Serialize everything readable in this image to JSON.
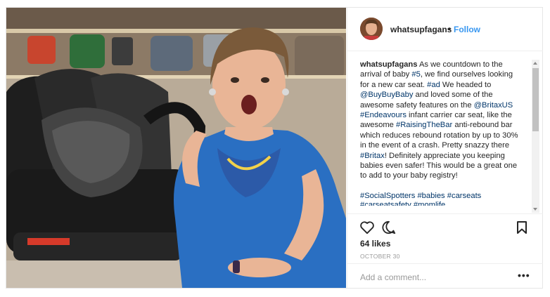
{
  "post": {
    "username": "whatsupfagans",
    "separator": "•",
    "follow_label": "Follow",
    "caption_user": "whatsupfagans",
    "caption_parts": [
      {
        "t": "As we countdown to the arrival of baby ",
        "k": "text"
      },
      {
        "t": "#5",
        "k": "link"
      },
      {
        "t": ", we find ourselves looking for a new car seat. ",
        "k": "text"
      },
      {
        "t": "#ad",
        "k": "link"
      },
      {
        "t": " We headed to ",
        "k": "text"
      },
      {
        "t": "@BuyBuyBaby",
        "k": "link"
      },
      {
        "t": " and loved some of the awesome safety features on the ",
        "k": "text"
      },
      {
        "t": "@BritaxUS",
        "k": "link"
      },
      {
        "t": " ",
        "k": "text"
      },
      {
        "t": "#Endeavours",
        "k": "link"
      },
      {
        "t": " infant carrier car seat, like the awesome ",
        "k": "text"
      },
      {
        "t": "#RaisingTheBar",
        "k": "link"
      },
      {
        "t": " anti-rebound bar which reduces rebound rotation by up to 30% in the event of a crash. Pretty snazzy there ",
        "k": "text"
      },
      {
        "t": "#Britax",
        "k": "link"
      },
      {
        "t": "! Definitely appreciate you keeping babies even safer! This would be a great one to add to your baby registry!",
        "k": "text"
      }
    ],
    "hashtags_line": "#SocialSpotters #babies #carseats",
    "hashtags_cut": "#carseatsafety #momlife",
    "likes": "64 likes",
    "date": "OCTOBER 30",
    "comment_placeholder": "Add a comment...",
    "more_label": "•••"
  },
  "icons": [
    "heart-icon",
    "comment-icon",
    "bookmark-icon",
    "more-icon"
  ],
  "colors": {
    "link": "#003569",
    "follow": "#3897f0",
    "border": "#efefef",
    "muted": "#999999"
  }
}
